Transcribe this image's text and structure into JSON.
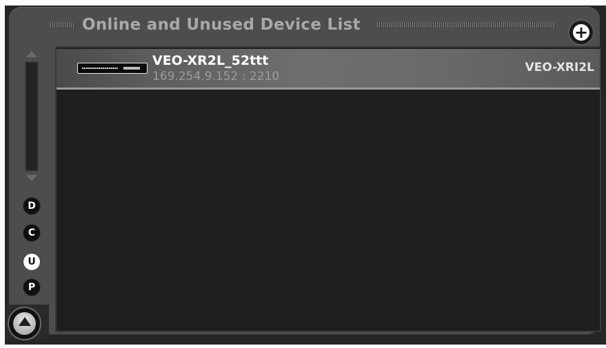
{
  "panel": {
    "title": "Online and Unused Device List",
    "add_icon": "plus-circle-icon",
    "add_symbol": "+"
  },
  "devices": [
    {
      "name": "VEO-XR2L_52ttt",
      "address": "169.254.9.152 : 2210",
      "model": "VEO-XRI2L",
      "icon": "device-thumbnail-icon"
    }
  ],
  "filters": [
    {
      "letter": "D",
      "active": false
    },
    {
      "letter": "C",
      "active": false
    },
    {
      "letter": "U",
      "active": true
    },
    {
      "letter": "P",
      "active": false
    }
  ],
  "scrollbar": {
    "up_icon": "arrow-up-icon",
    "down_icon": "arrow-down-icon"
  },
  "eject_icon": "eject-icon",
  "colors": {
    "background": "#262626",
    "panel": "#4d4d4d",
    "list": "#1f1f1f",
    "selected_row": "#6a6a6a",
    "title": "#a9a9a9"
  }
}
